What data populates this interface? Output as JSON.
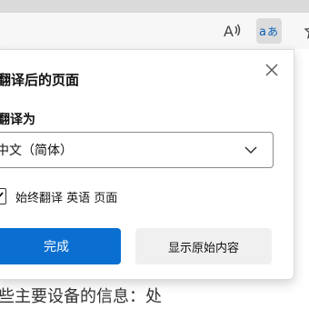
{
  "toolbar": {
    "read_aloud_icon": "read-aloud-icon",
    "translate_icon": "translate-icon",
    "favorite_icon": "favorite-icon"
  },
  "popup": {
    "title": "翻译后的页面",
    "translate_to_label": "翻译为",
    "language_selected": "中文（简体）",
    "always_translate_text": "始终翻译 英语 页面",
    "always_translate_checked": true,
    "done_label": "完成",
    "show_original_label": "显示原始内容"
  },
  "page": {
    "body_text": "些主要设备的信息：处"
  },
  "colors": {
    "accent": "#0a6fd0",
    "secondary_button": "#f0f0f0",
    "toolbar_active": "#dcdcdc"
  }
}
